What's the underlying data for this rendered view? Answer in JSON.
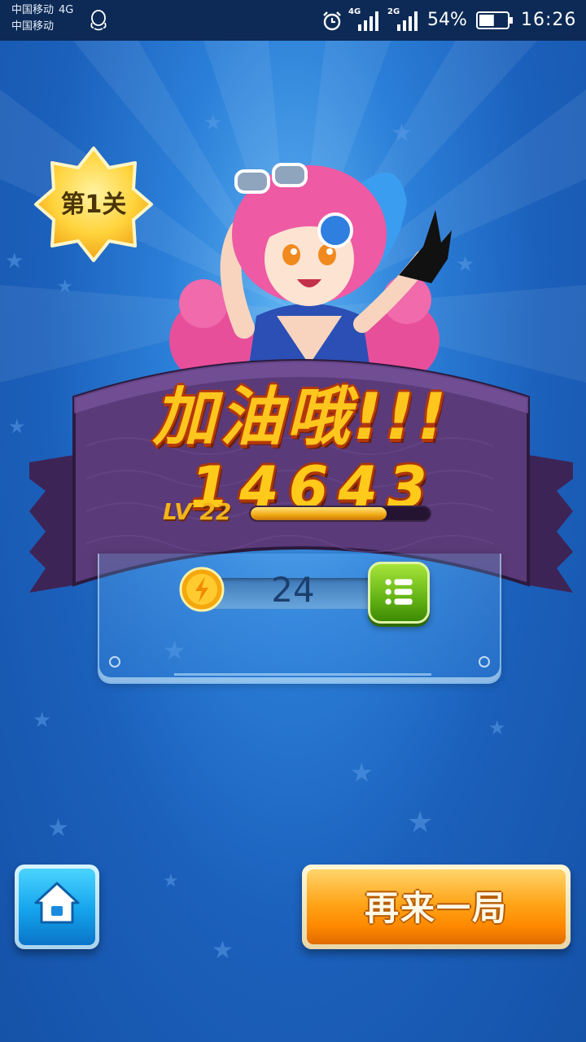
{
  "status_bar": {
    "carrier_1": "中国移动",
    "carrier_1_network": "4G",
    "carrier_2": "中国移动",
    "sim1_network": "4G",
    "sim2_network": "2G",
    "battery_percent": "54%",
    "battery_level": 0.54,
    "time": "16:26",
    "icons": [
      "qq-icon",
      "alarm-icon",
      "signal-icon",
      "battery-icon"
    ]
  },
  "game": {
    "level_label": "第1关",
    "cheer_text": "加油哦!!!",
    "score": "14643",
    "player_level": "LV 22",
    "xp_progress": 0.76,
    "coins": "24",
    "buttons": {
      "replay_label": "再来一局",
      "home_icon": "home-icon",
      "list_icon": "list-icon"
    },
    "colors": {
      "background_blue": "#1b60bb",
      "ribbon_purple": "#5a3a78",
      "score_gold": "#ffca1a",
      "replay_orange": "#ff9a10",
      "home_cyan": "#14a3ec",
      "list_green": "#64b415"
    }
  }
}
